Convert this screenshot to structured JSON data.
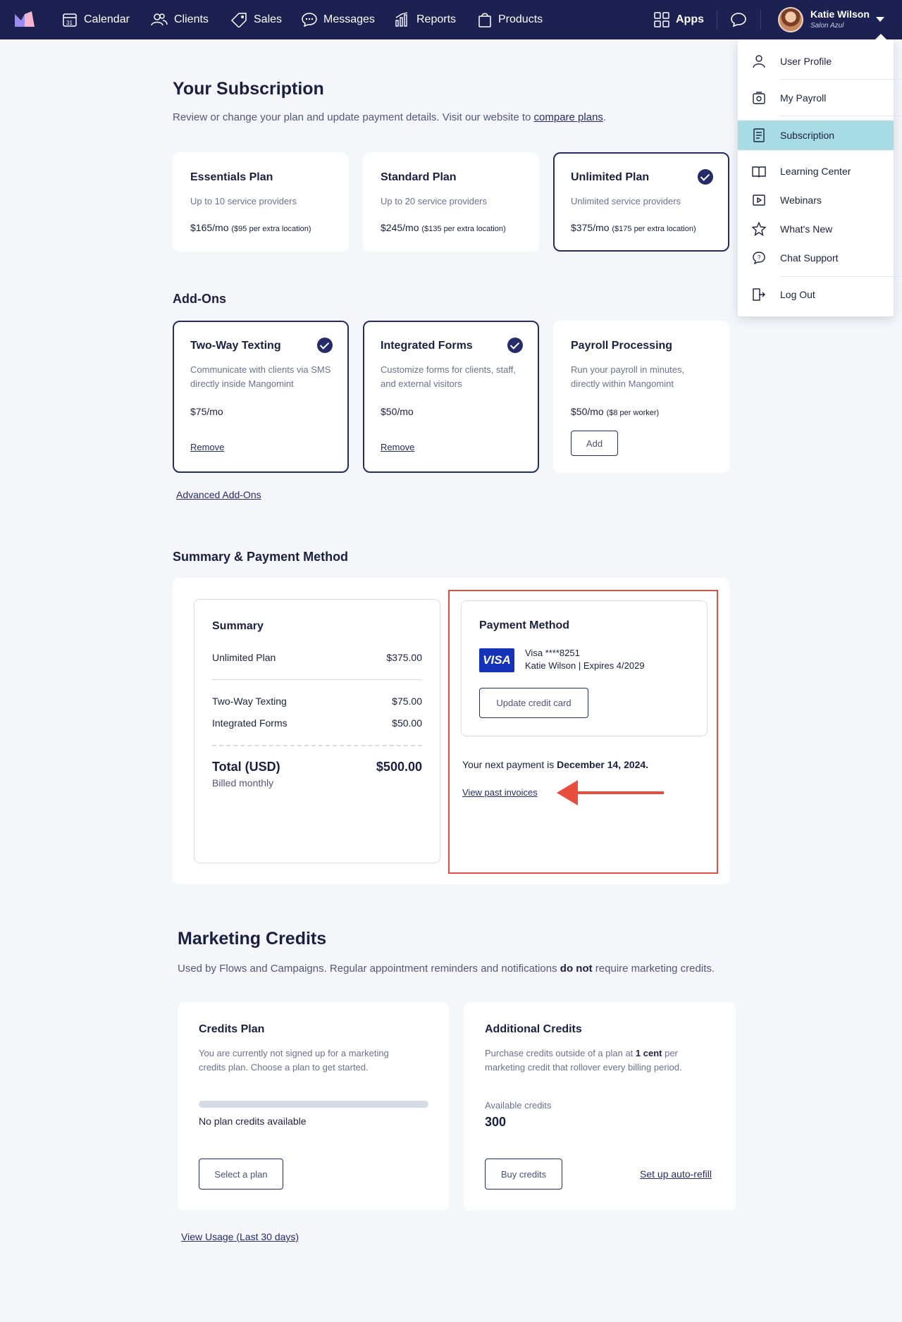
{
  "nav": {
    "items": [
      {
        "label": "Calendar",
        "icon": "calendar-icon"
      },
      {
        "label": "Clients",
        "icon": "clients-icon"
      },
      {
        "label": "Sales",
        "icon": "sales-tag-icon"
      },
      {
        "label": "Messages",
        "icon": "messages-icon"
      },
      {
        "label": "Reports",
        "icon": "reports-icon"
      },
      {
        "label": "Products",
        "icon": "products-icon"
      }
    ],
    "apps_label": "Apps",
    "user": {
      "name": "Katie Wilson",
      "salon": "Salon Azul"
    }
  },
  "dropdown": {
    "items": [
      {
        "label": "User Profile",
        "icon": "user-icon"
      },
      {
        "label": "My Payroll",
        "icon": "payroll-icon"
      },
      {
        "label": "Subscription",
        "icon": "subscription-icon",
        "active": true
      },
      {
        "label": "Learning Center",
        "icon": "book-icon"
      },
      {
        "label": "Webinars",
        "icon": "webinar-icon"
      },
      {
        "label": "What's New",
        "icon": "star-icon"
      },
      {
        "label": "Chat Support",
        "icon": "chat-support-icon"
      },
      {
        "label": "Log Out",
        "icon": "logout-icon"
      }
    ]
  },
  "subscription": {
    "title": "Your Subscription",
    "desc_prefix": "Review or change your plan and update payment details. Visit our website to ",
    "desc_link": "compare plans",
    "desc_suffix": ".",
    "plans": [
      {
        "name": "Essentials Plan",
        "sub": "Up to 10 service providers",
        "price": "$165/mo",
        "extra": "($95 per extra location)",
        "selected": false
      },
      {
        "name": "Standard Plan",
        "sub": "Up to 20 service providers",
        "price": "$245/mo",
        "extra": "($135 per extra location)",
        "selected": false
      },
      {
        "name": "Unlimited Plan",
        "sub": "Unlimited service providers",
        "price": "$375/mo",
        "extra": "($175 per extra location)",
        "selected": true
      }
    ]
  },
  "addons": {
    "title": "Add-Ons",
    "items": [
      {
        "name": "Two-Way Texting",
        "sub": "Communicate with clients via SMS directly inside Mangomint",
        "price": "$75/mo",
        "extra": "",
        "action": "Remove",
        "selected": true
      },
      {
        "name": "Integrated Forms",
        "sub": "Customize forms for clients, staff, and external visitors",
        "price": "$50/mo",
        "extra": "",
        "action": "Remove",
        "selected": true
      },
      {
        "name": "Payroll Processing",
        "sub": "Run your payroll in minutes, directly within Mangomint",
        "price": "$50/mo",
        "extra": "($8 per worker)",
        "action": "Add",
        "selected": false
      }
    ],
    "advanced_link": "Advanced Add-Ons"
  },
  "summary": {
    "section_title": "Summary & Payment Method",
    "title": "Summary",
    "plan_row": {
      "label": "Unlimited Plan",
      "value": "$375.00"
    },
    "addon_rows": [
      {
        "label": "Two-Way Texting",
        "value": "$75.00"
      },
      {
        "label": "Integrated Forms",
        "value": "$50.00"
      }
    ],
    "total_label": "Total (USD)",
    "total_value": "$500.00",
    "billing": "Billed monthly"
  },
  "payment": {
    "title": "Payment Method",
    "card_brand": "VISA",
    "card_number": "Visa ****8251",
    "card_holder": "Katie Wilson | Expires 4/2029",
    "update_button": "Update credit card",
    "next_prefix": "Your next payment is ",
    "next_date": "December 14, 2024.",
    "invoices_link": "View past invoices"
  },
  "marketing": {
    "title": "Marketing Credits",
    "desc_prefix": "Used by Flows and Campaigns. Regular appointment reminders and notifications ",
    "desc_bold": "do not",
    "desc_suffix": " require marketing credits.",
    "credits_plan": {
      "title": "Credits Plan",
      "desc": "You are currently not signed up for a marketing credits plan. Choose a plan to get started.",
      "progress_fraction": 0,
      "status": "No plan credits available",
      "button": "Select a plan"
    },
    "additional": {
      "title": "Additional Credits",
      "desc_prefix": "Purchase credits outside of a plan at ",
      "desc_bold": "1 cent",
      "desc_suffix": " per marketing credit that rollover every billing period.",
      "available_label": "Available credits",
      "available_value": "300",
      "button": "Buy credits",
      "auto_refill": "Set up auto-refill"
    },
    "usage_link": "View Usage (Last 30 days)"
  },
  "colors": {
    "nav_bg": "#1c2152",
    "accent": "#262c6b",
    "highlight_red": "#e74c3c",
    "active_menu": "#a7dce4"
  }
}
